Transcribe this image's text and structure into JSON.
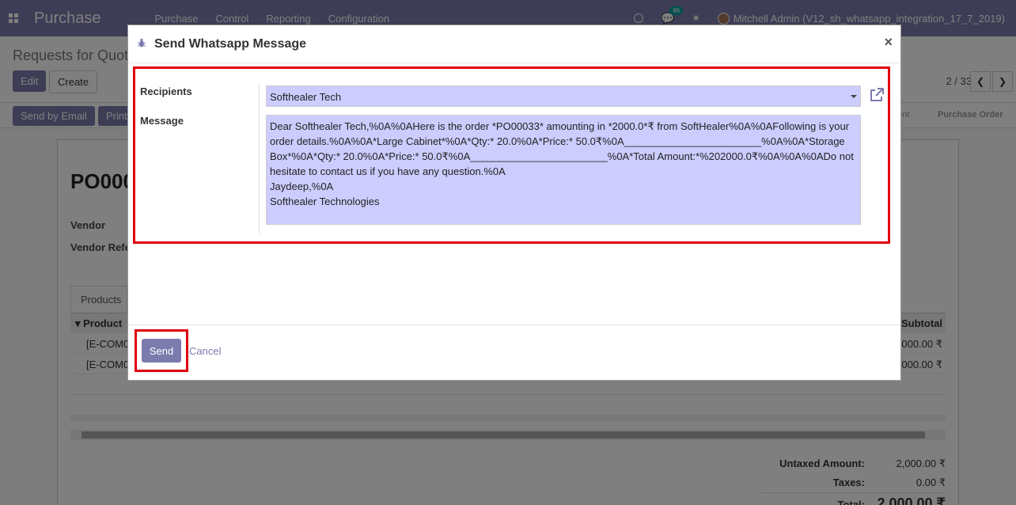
{
  "navbar": {
    "brand": "Purchase",
    "menu": [
      "Purchase",
      "Control",
      "Reporting",
      "Configuration"
    ],
    "chat_count": "86",
    "user_label": "Mitchell Admin (V12_sh_whatsapp_integration_17_7_2019)"
  },
  "control_panel": {
    "breadcrumb": "Requests for Quot",
    "edit_label": "Edit",
    "create_label": "Create",
    "pager": "2 / 33"
  },
  "statusbar": {
    "send_email_label": "Send by Email",
    "print_label": "Print",
    "stage_sent": "ent",
    "stage_po": "Purchase Order"
  },
  "form": {
    "title": "PO000",
    "vendor_label": "Vendor",
    "vendor_ref_label": "Vendor Refe",
    "tab_products": "Products",
    "col_product": "Product",
    "col_subtotal": "Subtotal",
    "rows": [
      {
        "product": "[E-COM0",
        "subtotal": "000.00 ₹"
      },
      {
        "product": "[E-COM0",
        "subtotal": "000.00 ₹"
      }
    ],
    "untaxed_label": "Untaxed Amount:",
    "untaxed_value": "2,000.00 ₹",
    "taxes_label": "Taxes:",
    "taxes_value": "0.00 ₹",
    "total_label": "Total:",
    "total_value": "2,000.00 ₹"
  },
  "modal": {
    "title": "Send Whatsapp Message",
    "close": "×",
    "recipients_label": "Recipients",
    "recipients_value": "Softhealer Tech",
    "message_label": "Message",
    "message_value": "Dear Softhealer Tech,%0A%0AHere is the order *PO00033* amounting in *2000.0*₹ from SoftHealer%0A%0AFollowing is your order details.%0A%0A*Large Cabinet*%0A*Qty:* 20.0%0A*Price:* 50.0₹%0A________________________%0A%0A*Storage Box*%0A*Qty:* 20.0%0A*Price:* 50.0₹%0A________________________%0A*Total Amount:*%202000.0₹%0A%0A%0ADo not hesitate to contact us if you have any question.%0A\nJaydeep,%0A\nSofthealer Technologies",
    "send_label": "Send",
    "cancel_label": "Cancel"
  },
  "colors": {
    "brand": "#7c7bad",
    "highlight_border": "#e0000e",
    "field_bg": "#ccccff"
  }
}
